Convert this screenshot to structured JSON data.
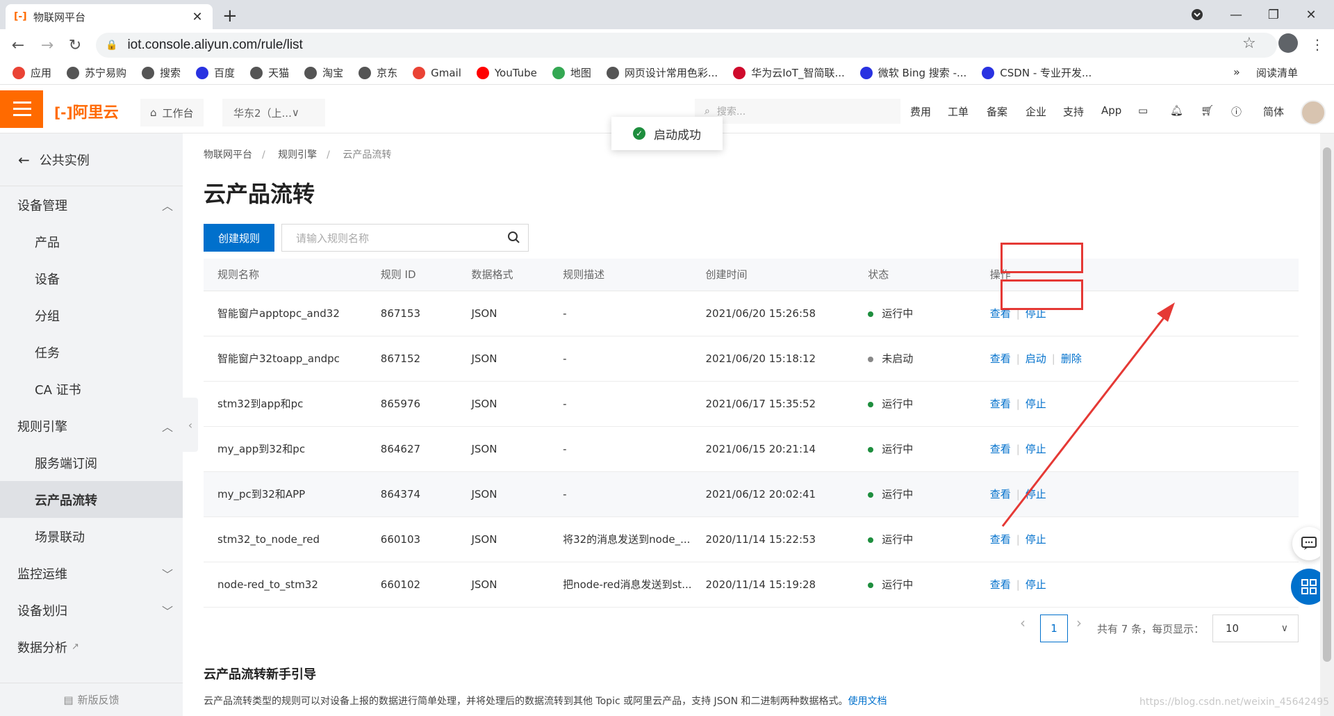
{
  "browser": {
    "tab_title": "物联网平台",
    "favicon": "[-]",
    "url": "iot.console.aliyun.com/rule/list",
    "bookmarks": [
      {
        "label": "应用",
        "color": "#ea4335"
      },
      {
        "label": "苏宁易购",
        "color": "#555555"
      },
      {
        "label": "搜索",
        "color": "#555555"
      },
      {
        "label": "百度",
        "color": "#2932e1"
      },
      {
        "label": "天猫",
        "color": "#555555"
      },
      {
        "label": "淘宝",
        "color": "#555555"
      },
      {
        "label": "京东",
        "color": "#555555"
      },
      {
        "label": "Gmail",
        "color": "#ea4335"
      },
      {
        "label": "YouTube",
        "color": "#ff0000"
      },
      {
        "label": "地图",
        "color": "#34a853"
      },
      {
        "label": "网页设计常用色彩...",
        "color": "#555555"
      },
      {
        "label": "华为云IoT_智简联...",
        "color": "#cf0a2c"
      },
      {
        "label": "微软 Bing 搜索 -...",
        "color": "#2932e1"
      },
      {
        "label": "CSDN - 专业开发...",
        "color": "#2932e1"
      }
    ],
    "bookmarks_more": "»",
    "reading_list": "阅读清单"
  },
  "header": {
    "logo": "阿里云",
    "workbench": "工作台",
    "region": "华东2（上...",
    "search_placeholder": "搜索...",
    "links": [
      "费用",
      "工单",
      "备案",
      "企业",
      "支持",
      "App"
    ],
    "lang": "简体"
  },
  "sidebar": {
    "back_label": "公共实例",
    "groups": [
      {
        "label": "设备管理",
        "expanded": true,
        "items": [
          "产品",
          "设备",
          "分组",
          "任务",
          "CA 证书"
        ]
      },
      {
        "label": "规则引擎",
        "expanded": true,
        "items": [
          "服务端订阅",
          "云产品流转",
          "场景联动"
        ]
      },
      {
        "label": "监控运维",
        "expanded": false,
        "items": []
      },
      {
        "label": "设备划归",
        "expanded": false,
        "items": []
      }
    ],
    "data_analysis": "数据分析",
    "active_item": "云产品流转",
    "feedback": "新版反馈"
  },
  "main": {
    "breadcrumb": [
      "物联网平台",
      "规则引擎",
      "云产品流转"
    ],
    "title": "云产品流转",
    "create_button": "创建规则",
    "search_placeholder": "请输入规则名称",
    "columns": [
      "规则名称",
      "规则 ID",
      "数据格式",
      "规则描述",
      "创建时间",
      "状态",
      "操作"
    ],
    "rows": [
      {
        "name": "智能窗户apptopc_and32",
        "id": "867153",
        "format": "JSON",
        "desc": "-",
        "time": "2021/06/20 15:26:58",
        "status": "运行中",
        "running": true,
        "ops": [
          "查看",
          "停止"
        ]
      },
      {
        "name": "智能窗户32toapp_andpc",
        "id": "867152",
        "format": "JSON",
        "desc": "-",
        "time": "2021/06/20 15:18:12",
        "status": "未启动",
        "running": false,
        "ops": [
          "查看",
          "启动",
          "删除"
        ]
      },
      {
        "name": "stm32到app和pc",
        "id": "865976",
        "format": "JSON",
        "desc": "-",
        "time": "2021/06/17 15:35:52",
        "status": "运行中",
        "running": true,
        "ops": [
          "查看",
          "停止"
        ]
      },
      {
        "name": "my_app到32和pc",
        "id": "864627",
        "format": "JSON",
        "desc": "-",
        "time": "2021/06/15 20:21:14",
        "status": "运行中",
        "running": true,
        "ops": [
          "查看",
          "停止"
        ]
      },
      {
        "name": "my_pc到32和APP",
        "id": "864374",
        "format": "JSON",
        "desc": "-",
        "time": "2021/06/12 20:02:41",
        "status": "运行中",
        "running": true,
        "ops": [
          "查看",
          "停止"
        ]
      },
      {
        "name": "stm32_to_node_red",
        "id": "660103",
        "format": "JSON",
        "desc": "将32的消息发送到node_...",
        "time": "2020/11/14 15:22:53",
        "status": "运行中",
        "running": true,
        "ops": [
          "查看",
          "停止"
        ]
      },
      {
        "name": "node-red_to_stm32",
        "id": "660102",
        "format": "JSON",
        "desc": "把node-red消息发送到st...",
        "time": "2020/11/14 15:19:28",
        "status": "运行中",
        "running": true,
        "ops": [
          "查看",
          "停止"
        ]
      }
    ],
    "pagination": {
      "current_page": "1",
      "summary": "共有 7 条，每页显示：",
      "page_size": "10"
    },
    "guide_title": "云产品流转新手引导",
    "guide_text": "云产品流转类型的规则可以对设备上报的数据进行简单处理，并将处理后的数据流转到其他 Topic 或阿里云产品，支持 JSON 和二进制两种数据格式。",
    "guide_link": "使用文档"
  },
  "toast": "启动成功",
  "watermark": "https://blog.csdn.net/weixin_45642495",
  "colors": {
    "accent": "#ff6a00",
    "link": "#0070cc",
    "running": "#1e8e3e",
    "stopped": "#888888",
    "annotation": "#e53935"
  }
}
